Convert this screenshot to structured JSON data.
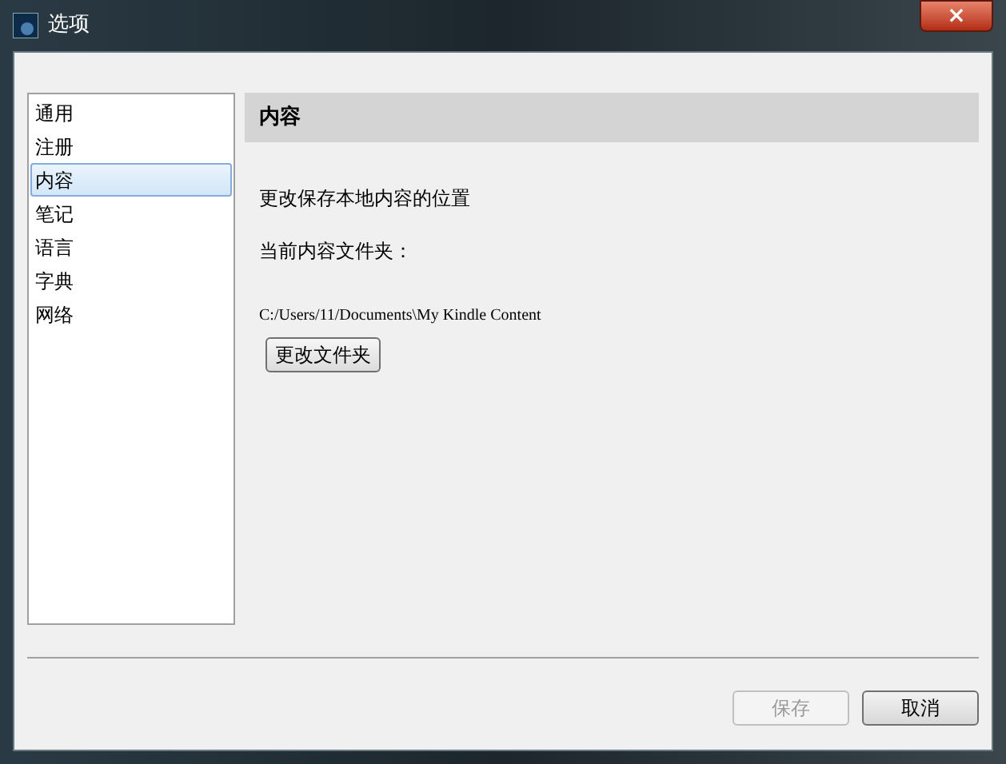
{
  "window": {
    "title": "选项",
    "close_button": "×"
  },
  "sidebar": {
    "items": [
      {
        "label": "通用",
        "selected": false
      },
      {
        "label": "注册",
        "selected": false
      },
      {
        "label": "内容",
        "selected": true
      },
      {
        "label": "笔记",
        "selected": false
      },
      {
        "label": "语言",
        "selected": false
      },
      {
        "label": "字典",
        "selected": false
      },
      {
        "label": "网络",
        "selected": false
      }
    ]
  },
  "panel": {
    "heading": "内容",
    "description": "更改保存本地内容的位置",
    "folder_label": "当前内容文件夹：",
    "folder_path": "C:/Users/11/Documents\\My Kindle Content",
    "change_button": "更改文件夹"
  },
  "buttons": [
    {
      "label": "保存",
      "disabled": true
    },
    {
      "label": "取消",
      "disabled": false
    }
  ]
}
